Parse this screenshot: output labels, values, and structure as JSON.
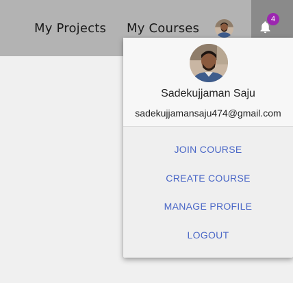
{
  "header": {
    "nav": [
      {
        "label": "My Projects"
      },
      {
        "label": "My Courses"
      }
    ],
    "notifications": {
      "count": "4",
      "icon": "bell-icon"
    }
  },
  "profile_menu": {
    "name": "Sadekujjaman Saju",
    "email": "sadekujjamansaju474@gmail.com",
    "items": [
      {
        "label": "JOIN COURSE"
      },
      {
        "label": "CREATE COURSE"
      },
      {
        "label": "MANAGE PROFILE"
      },
      {
        "label": "LOGOUT"
      }
    ]
  },
  "colors": {
    "topbar": "#b3b3b3",
    "bell_bg": "#8a8a8a",
    "badge": "#9c27b0",
    "menu_link": "#4a67c7"
  }
}
